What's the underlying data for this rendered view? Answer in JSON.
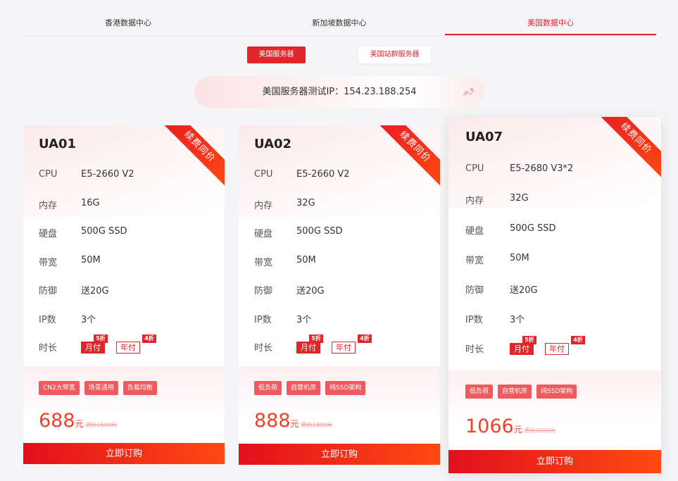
{
  "dc_tabs": [
    "香港数据中心",
    "新加坡数据中心",
    "美国数据中心"
  ],
  "sub_tabs": [
    "美国服务器",
    "美国站群服务器"
  ],
  "test_ip": "美国服务器测试IP：154.23.188.254",
  "spec_labels": [
    "CPU",
    "内存",
    "硬盘",
    "带宽",
    "防御",
    "IP数"
  ],
  "duration_label": "时长",
  "monthly_label": "月付",
  "yearly_label": "年付",
  "monthly_discount": "5折",
  "yearly_discount": "4折",
  "ribbon_text": "续费同价",
  "buy_label": "立即订购",
  "price_unit": "元",
  "colors": {
    "accent": "#e0252b",
    "tag": "#f05a5f",
    "price": "#f0402a"
  },
  "cards": [
    {
      "title": "UA01",
      "specs": [
        "E5-2660 V2",
        "16G",
        "500G SSD",
        "50M",
        "送20G",
        "3个"
      ],
      "tags": [
        "CN2大带宽",
        "场景通用",
        "负载均衡"
      ],
      "price": "688",
      "original": "原价1500元"
    },
    {
      "title": "UA02",
      "specs": [
        "E5-2660 V2",
        "32G",
        "500G SSD",
        "50M",
        "送20G",
        "3个"
      ],
      "tags": [
        "低负荷",
        "自营机房",
        "纯SSD架构"
      ],
      "price": "888",
      "original": "原价1800元"
    },
    {
      "title": "UA07",
      "specs": [
        "E5-2680 V3*2",
        "32G",
        "500G SSD",
        "50M",
        "送20G",
        "3个"
      ],
      "tags": [
        "低负荷",
        "自营机房",
        "纯SSD架构"
      ],
      "price": "1066",
      "original": "原价2200元"
    }
  ]
}
